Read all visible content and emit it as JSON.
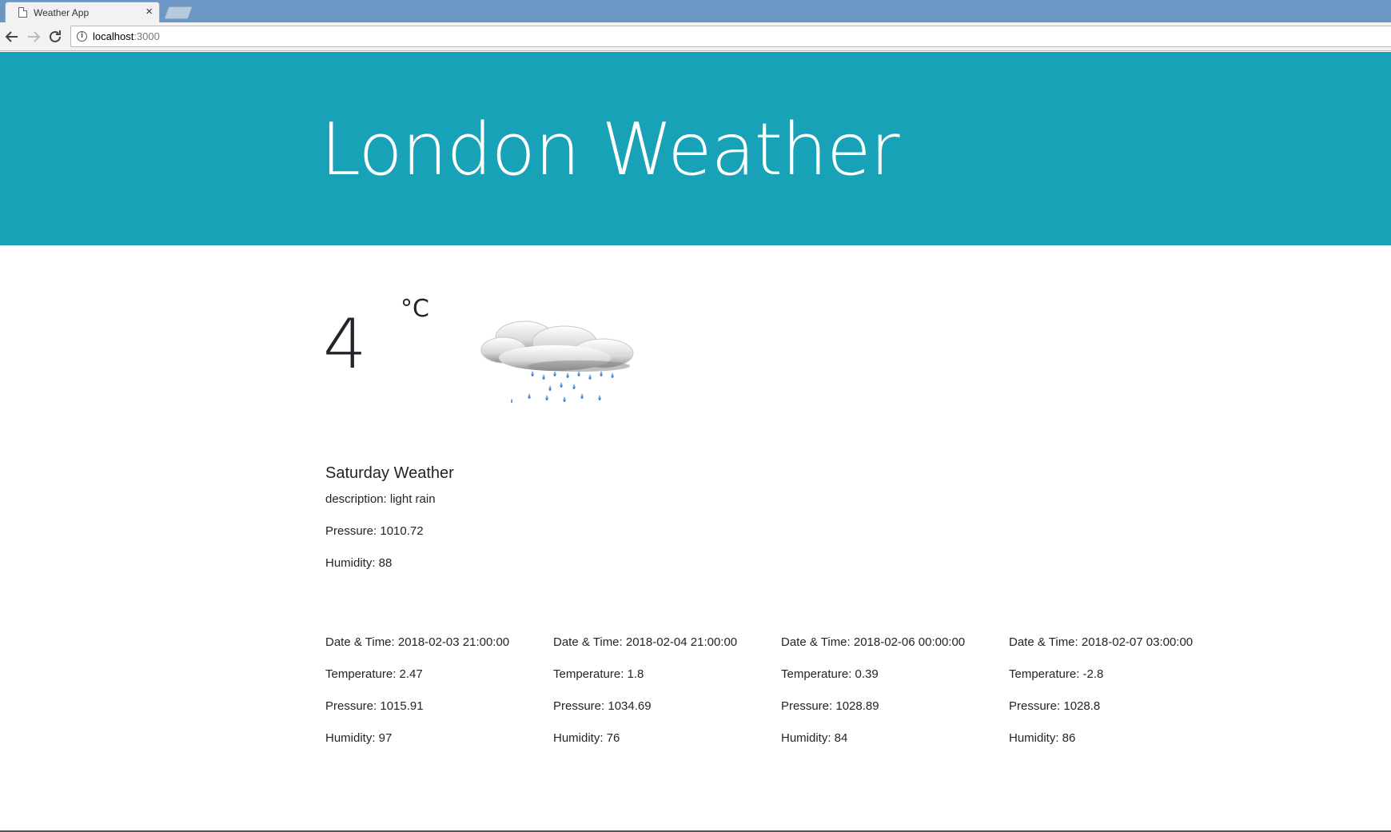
{
  "browser": {
    "tab_title": "Weather App",
    "tab_close": "×",
    "url_host": "localhost",
    "url_port": ":3000"
  },
  "header": {
    "title": "London Weather"
  },
  "current": {
    "temperature": "4",
    "unit": "°C",
    "icon": "light-rain-cloud-icon"
  },
  "today": {
    "heading": "Saturday Weather",
    "description": "description: light rain",
    "pressure": "Pressure: 1010.72",
    "humidity": "Humidity: 88"
  },
  "forecast": [
    {
      "datetime": "Date & Time: 2018-02-03 21:00:00",
      "temperature": "Temperature: 2.47",
      "pressure": "Pressure: 1015.91",
      "humidity": "Humidity: 97"
    },
    {
      "datetime": "Date & Time: 2018-02-04 21:00:00",
      "temperature": "Temperature: 1.8",
      "pressure": "Pressure: 1034.69",
      "humidity": "Humidity: 76"
    },
    {
      "datetime": "Date & Time: 2018-02-06 00:00:00",
      "temperature": "Temperature: 0.39",
      "pressure": "Pressure: 1028.89",
      "humidity": "Humidity: 84"
    },
    {
      "datetime": "Date & Time: 2018-02-07 03:00:00",
      "temperature": "Temperature: -2.8",
      "pressure": "Pressure: 1028.8",
      "humidity": "Humidity: 86"
    }
  ]
}
